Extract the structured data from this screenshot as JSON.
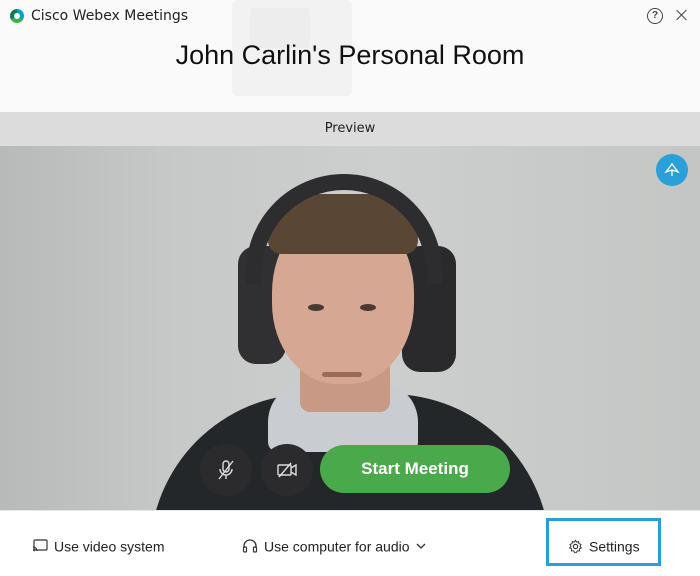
{
  "window": {
    "app_title": "Cisco Webex Meetings",
    "room_title": "John Carlin's Personal Room",
    "help_glyph": "?"
  },
  "preview": {
    "label": "Preview"
  },
  "controls": {
    "mute_icon": "microphone-muted-icon",
    "video_icon": "video-off-icon",
    "start_label": "Start Meeting",
    "pip_icon": "picture-in-picture-icon"
  },
  "bottom_bar": {
    "video_system_label": "Use video system",
    "audio_label": "Use computer for audio",
    "settings_label": "Settings"
  },
  "colors": {
    "start_button": "#4aa94a",
    "accent": "#2a9fd6",
    "preview_bar": "#dcdcdc"
  }
}
